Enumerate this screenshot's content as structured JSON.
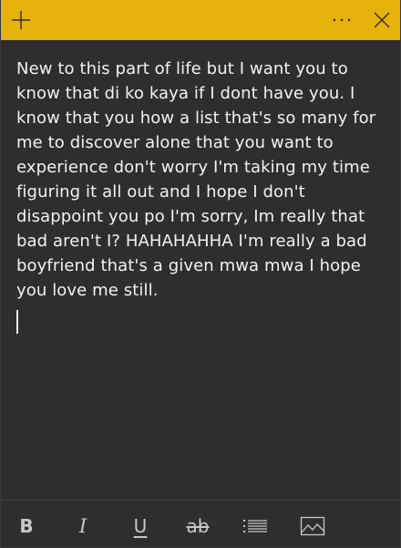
{
  "titlebar": {
    "accent_color": "#e6b30a",
    "add_icon": "plus-icon",
    "more_icon": "ellipsis-icon",
    "close_icon": "close-icon"
  },
  "note": {
    "text": "New to this part of life but I want you to know that di ko kaya if I dont have you. I know that you how a list that's so many for me to discover alone that you want to experience don't worry I'm taking my time figuring it all out and I hope I don't disappoint you po I'm sorry, Im really that bad aren't I? HAHAHAHHA I'm really a bad boyfriend that's a given mwa mwa I hope you love me still."
  },
  "toolbar": {
    "bold_label": "B",
    "italic_label": "I",
    "underline_label": "U",
    "strike_label": "ab",
    "bullets_icon": "bulleted-list-icon",
    "image_icon": "image-icon"
  }
}
